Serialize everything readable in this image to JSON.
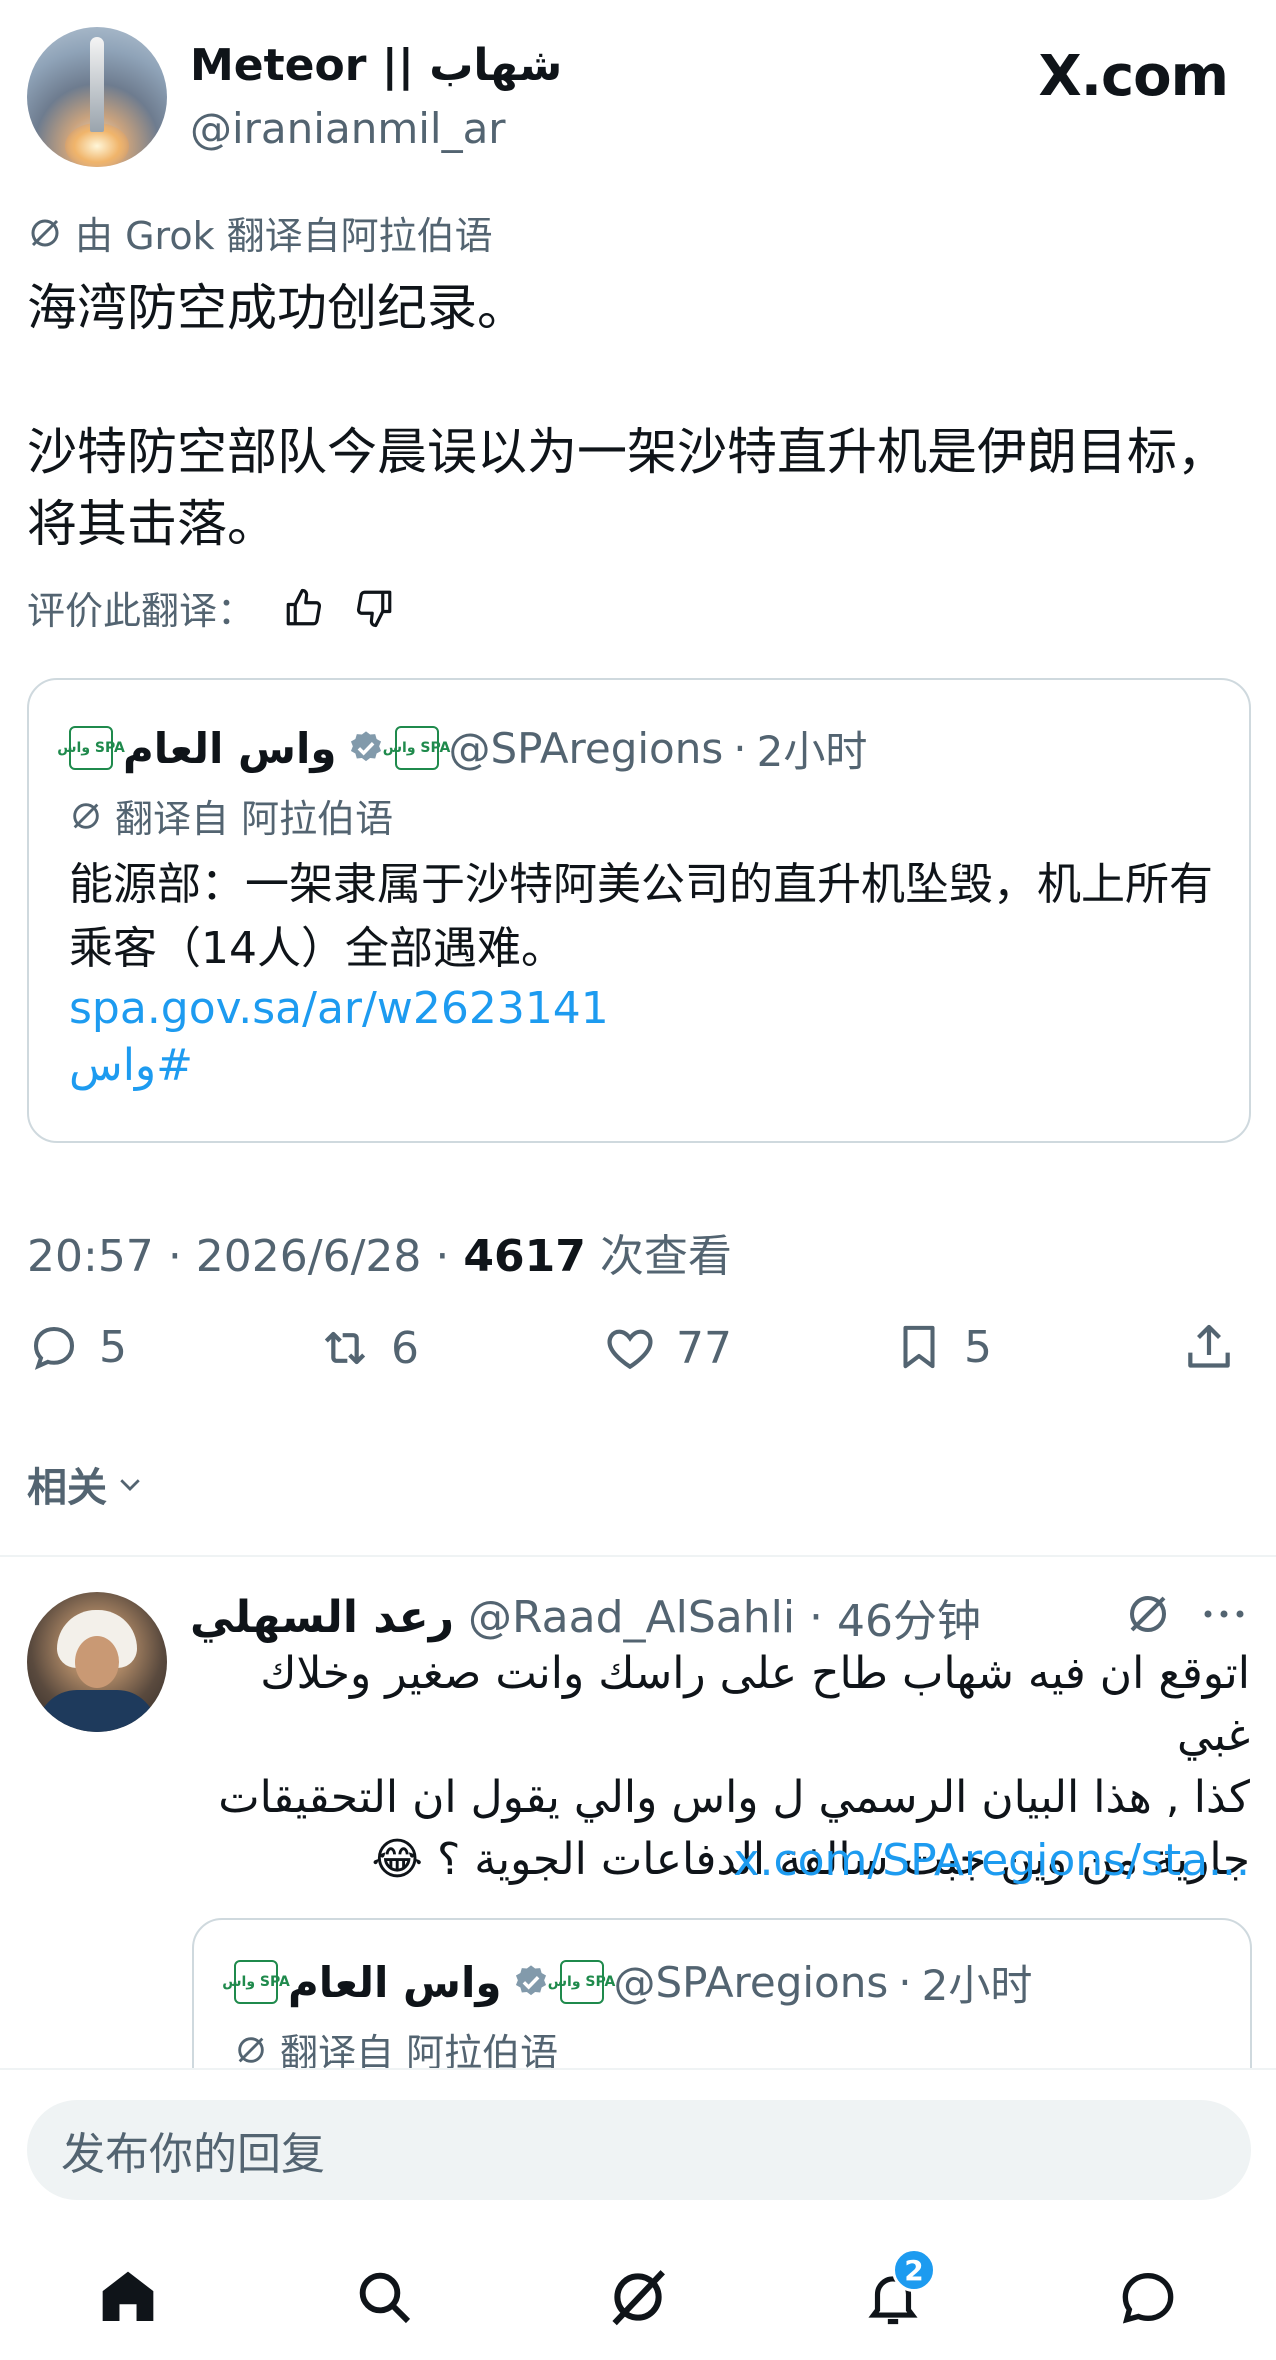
{
  "header": {
    "display_name": "Meteor || شهاب",
    "handle": "@iranianmil_ar",
    "site_logo": "X.com"
  },
  "tweet": {
    "translation_note": "由 Grok 翻译自阿拉伯语",
    "paragraph1": "海湾防空成功创纪录。",
    "paragraph2": "沙特防空部队今晨误以为一架沙特直升机是伊朗目标，将其击落。",
    "rate_label": "评价此翻译："
  },
  "quote": {
    "logo_text": "واس SPA",
    "name": "واس العام",
    "handle": "@SPAregions",
    "time": "2小时",
    "translation_note": "翻译自 阿拉伯语",
    "text": "能源部：一架隶属于沙特阿美公司的直升机坠毁，机上所有乘客（14人）全部遇难。",
    "link": "spa.gov.sa/ar/w2623141",
    "hashtag": "#واس"
  },
  "meta": {
    "time": "20:57",
    "date": "2026/6/28",
    "views_count": "4617",
    "views_label": "次查看"
  },
  "actions": {
    "replies": "5",
    "retweets": "6",
    "likes": "77",
    "bookmarks": "5"
  },
  "related": {
    "label": "相关"
  },
  "reply": {
    "name": "رعد السهلي",
    "handle": "@Raad_AlSahli",
    "time": "46分钟",
    "line1": "اتوقع ان فيه شهاب طاح على راسك وانت صغير وخلاك غبي",
    "line2": "كذا , هذا البيان الرسمي ل واس والي يقول ان التحقيقات",
    "line3": "جارية من وين جبت سالفة الدفاعات الجوية ؟ 😂",
    "link": "x.com/SPAregions/sta..."
  },
  "reply_quote": {
    "name": "واس العام",
    "handle": "@SPAregions",
    "time": "2小时",
    "translation_note": "翻译自 阿拉伯语"
  },
  "compose": {
    "placeholder": "发布你的回复"
  },
  "nav": {
    "notifications_badge": "2",
    "icons": [
      "home-icon",
      "search-icon",
      "grok-icon",
      "bell-icon",
      "message-icon"
    ]
  },
  "colors": {
    "link": "#1d9bf0",
    "muted": "#536471",
    "text": "#0f1419",
    "border": "#cfd9de"
  }
}
